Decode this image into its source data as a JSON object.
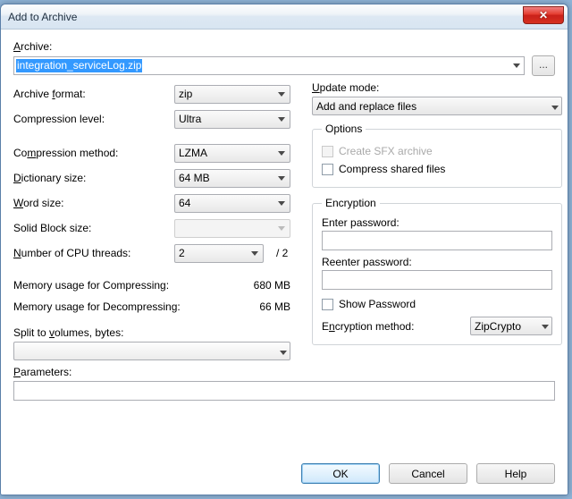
{
  "title": "Add to Archive",
  "archive": {
    "label": "Archive:",
    "value": "integration_serviceLog.zip",
    "browse": "..."
  },
  "left": {
    "format_label_pre": "Archive ",
    "format_label_u": "f",
    "format_label_post": "ormat:",
    "format_value": "zip",
    "level_label": "Compression level:",
    "level_value": "Ultra",
    "method_label_pre": "Co",
    "method_label_u": "m",
    "method_label_post": "pression method:",
    "method_value": "LZMA",
    "dict_label_u": "D",
    "dict_label_post": "ictionary size:",
    "dict_value": "64 MB",
    "word_label_u": "W",
    "word_label_post": "ord size:",
    "word_value": "64",
    "solid_label": "Solid Block size:",
    "solid_value": "",
    "threads_label_u": "N",
    "threads_label_post": "umber of CPU threads:",
    "threads_value": "2",
    "threads_total": "/ 2",
    "mem_compress_label": "Memory usage for Compressing:",
    "mem_compress_value": "680 MB",
    "mem_decompress_label": "Memory usage for Decompressing:",
    "mem_decompress_value": "66 MB",
    "split_label_pre": "Split to ",
    "split_label_u": "v",
    "split_label_post": "olumes, bytes:"
  },
  "right": {
    "update_label_u": "U",
    "update_label_post": "pdate mode:",
    "update_value": "Add and replace files",
    "options_legend": "Options",
    "sfx_label": "Create SFX archive",
    "shared_label": "Compress shared files",
    "enc_legend": "Encryption",
    "pwd_label": "Enter password:",
    "repwd_label": "Reenter password:",
    "show_label": "Show Password",
    "encm_label_pre": "E",
    "encm_label_u": "n",
    "encm_label_post": "cryption method:",
    "encm_value": "ZipCrypto"
  },
  "params_label_u": "P",
  "params_label_post": "arameters:",
  "buttons": {
    "ok": "OK",
    "cancel": "Cancel",
    "help": "Help"
  }
}
